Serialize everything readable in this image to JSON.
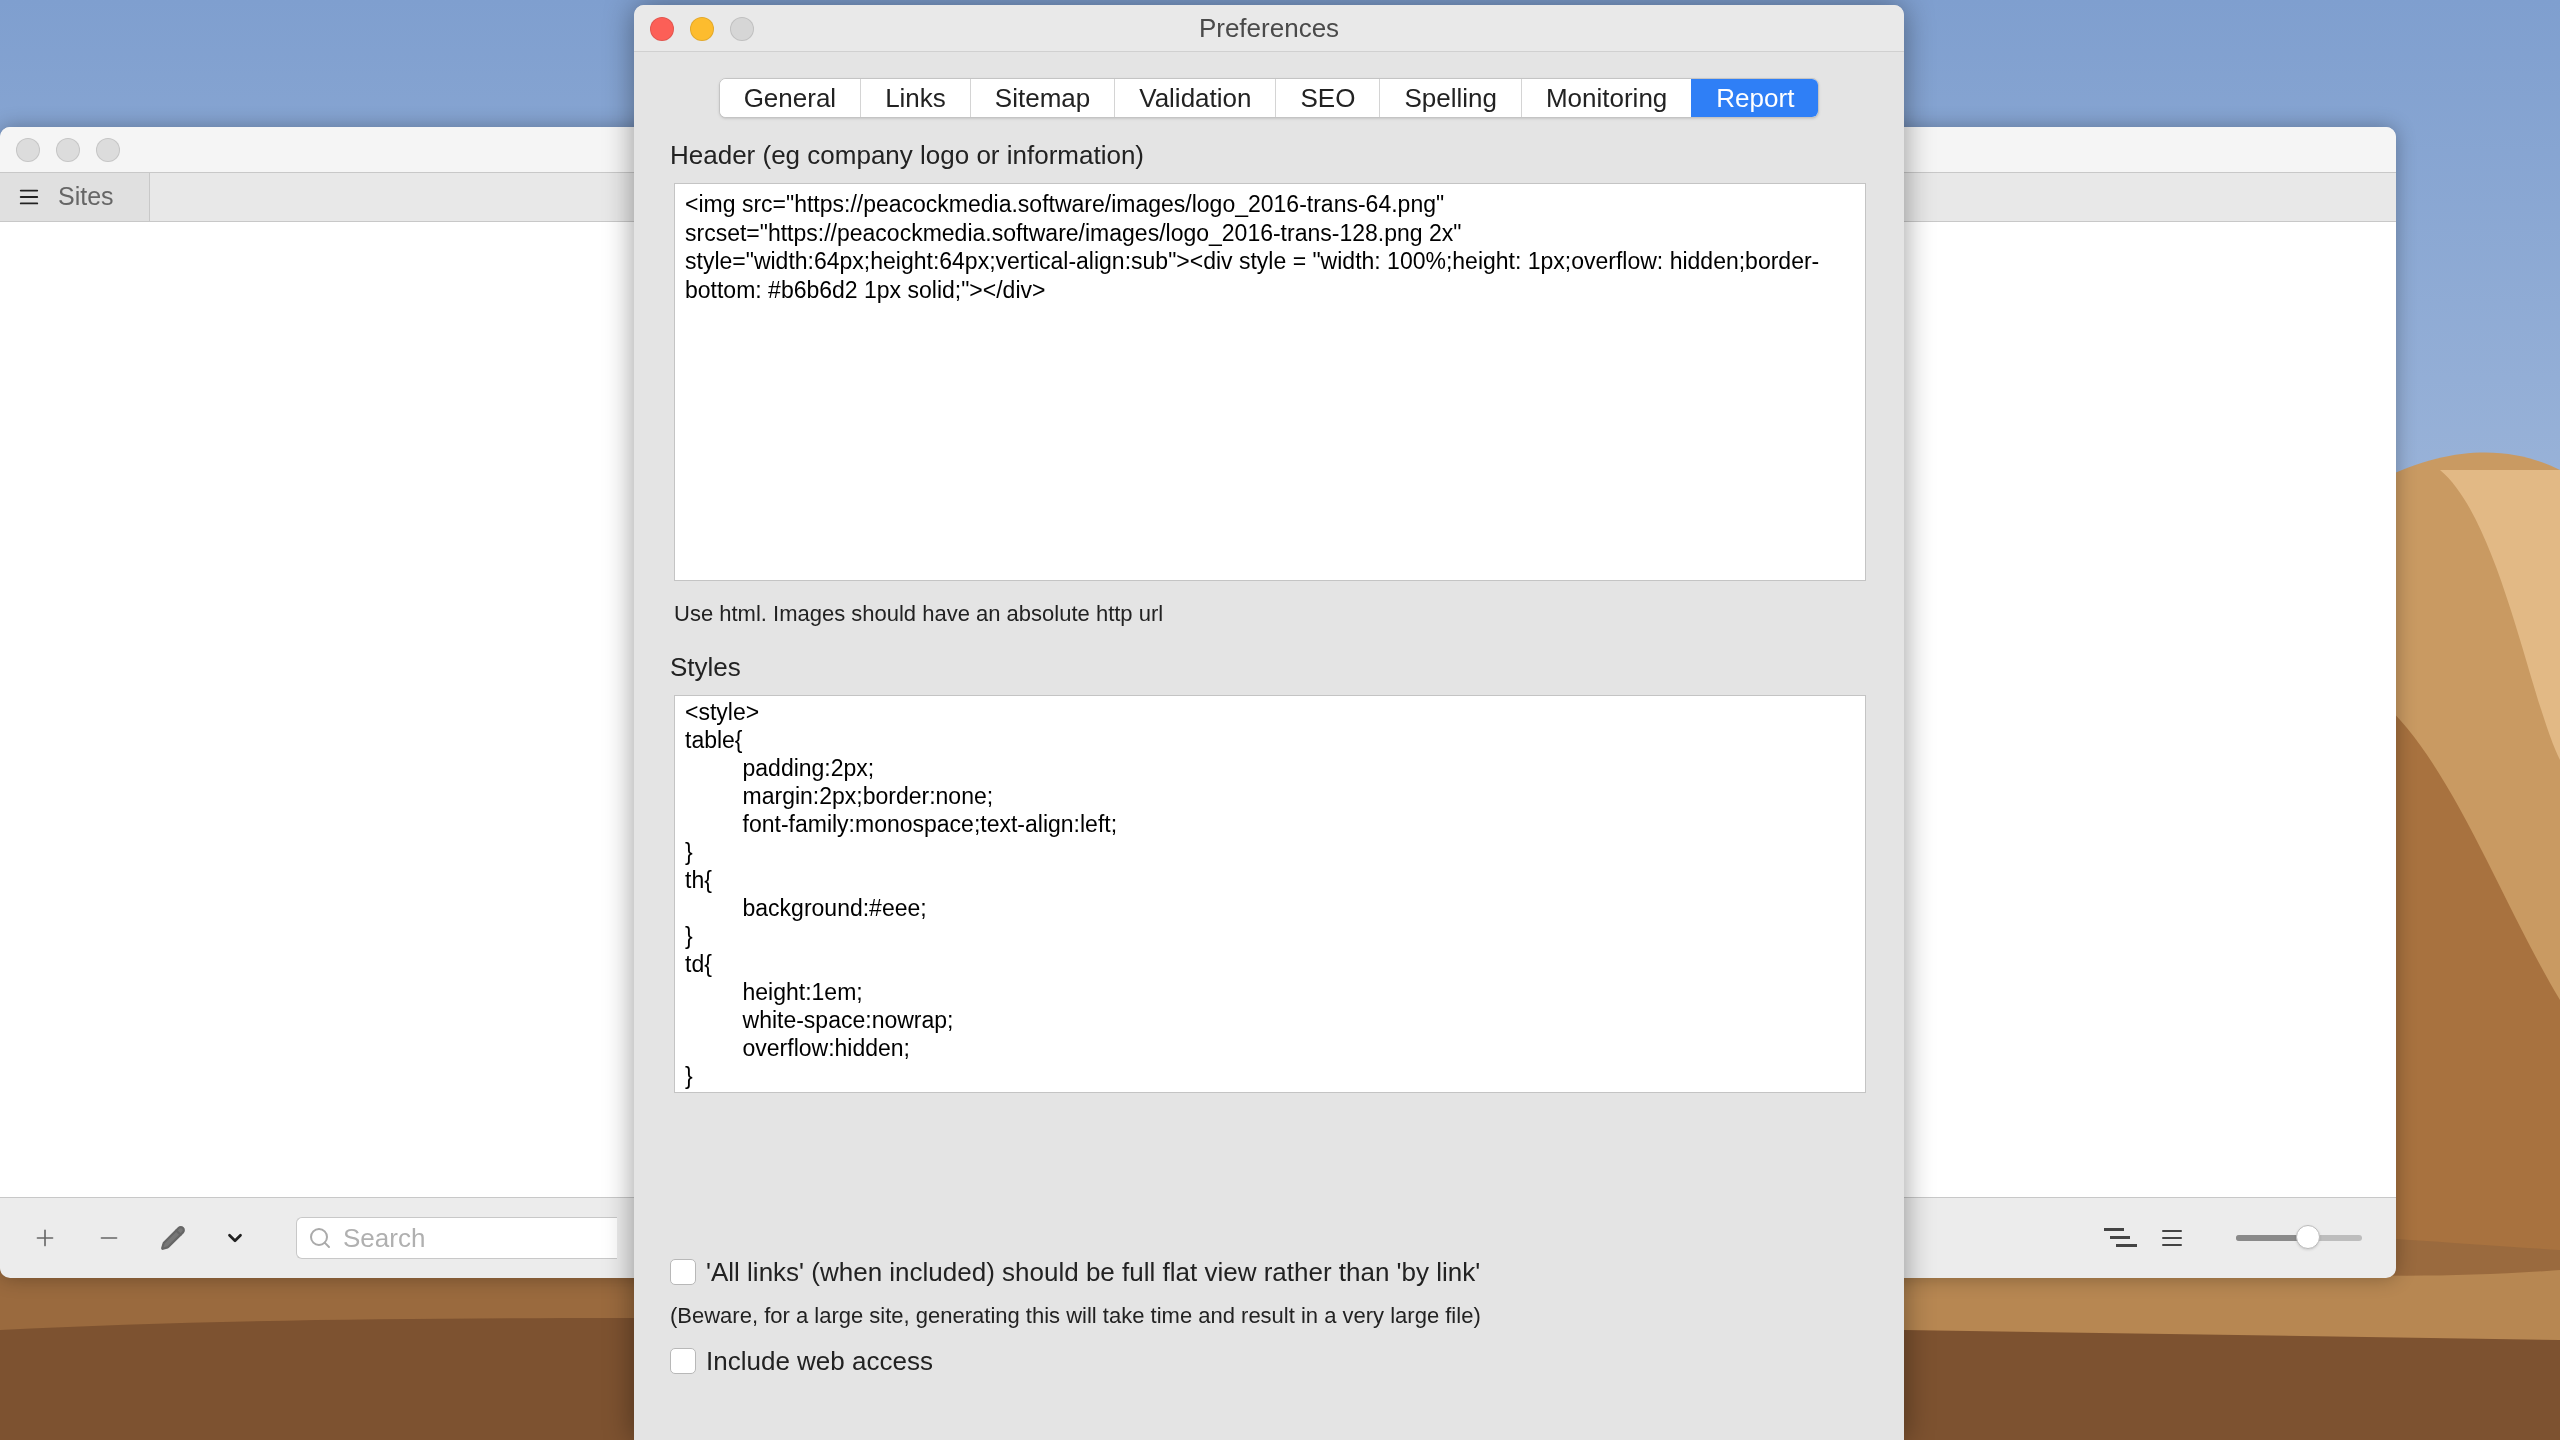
{
  "background_window": {
    "sidebar_tab": {
      "label": "Sites"
    },
    "search": {
      "placeholder": "Search"
    },
    "zoom_slider": {
      "level": 0.57
    }
  },
  "preferences": {
    "title": "Preferences",
    "tabs": [
      {
        "label": "General",
        "selected": false
      },
      {
        "label": "Links",
        "selected": false
      },
      {
        "label": "Sitemap",
        "selected": false
      },
      {
        "label": "Validation",
        "selected": false
      },
      {
        "label": "SEO",
        "selected": false
      },
      {
        "label": "Spelling",
        "selected": false
      },
      {
        "label": "Monitoring",
        "selected": false
      },
      {
        "label": "Report",
        "selected": true
      }
    ],
    "header": {
      "label": "Header (eg company logo or information)",
      "value": "<img src=\"https://peacockmedia.software/images/logo_2016-trans-64.png\" srcset=\"https://peacockmedia.software/images/logo_2016-trans-128.png 2x\" style=\"width:64px;height:64px;vertical-align:sub\"><div style = \"width: 100%;height: 1px;overflow: hidden;border-bottom: #b6b6d2 1px solid;\"></div>",
      "hint": "Use html. Images should have an absolute http url"
    },
    "styles": {
      "label": "Styles",
      "value": "<style>\ntable{\n\tpadding:2px;\n\tmargin:2px;border:none;\n\tfont-family:monospace;text-align:left;\n}\nth{\n\tbackground:#eee;\n}\ntd{\n\theight:1em;\n\twhite-space:nowrap;\n\toverflow:hidden;\n}"
    },
    "options": [
      {
        "label": "'All links' (when included) should be full flat view rather than 'by link'",
        "checked": false,
        "note": "(Beware, for a large site, generating this will take time and result in a very large file)"
      },
      {
        "label": "Include web access",
        "checked": false
      }
    ]
  }
}
